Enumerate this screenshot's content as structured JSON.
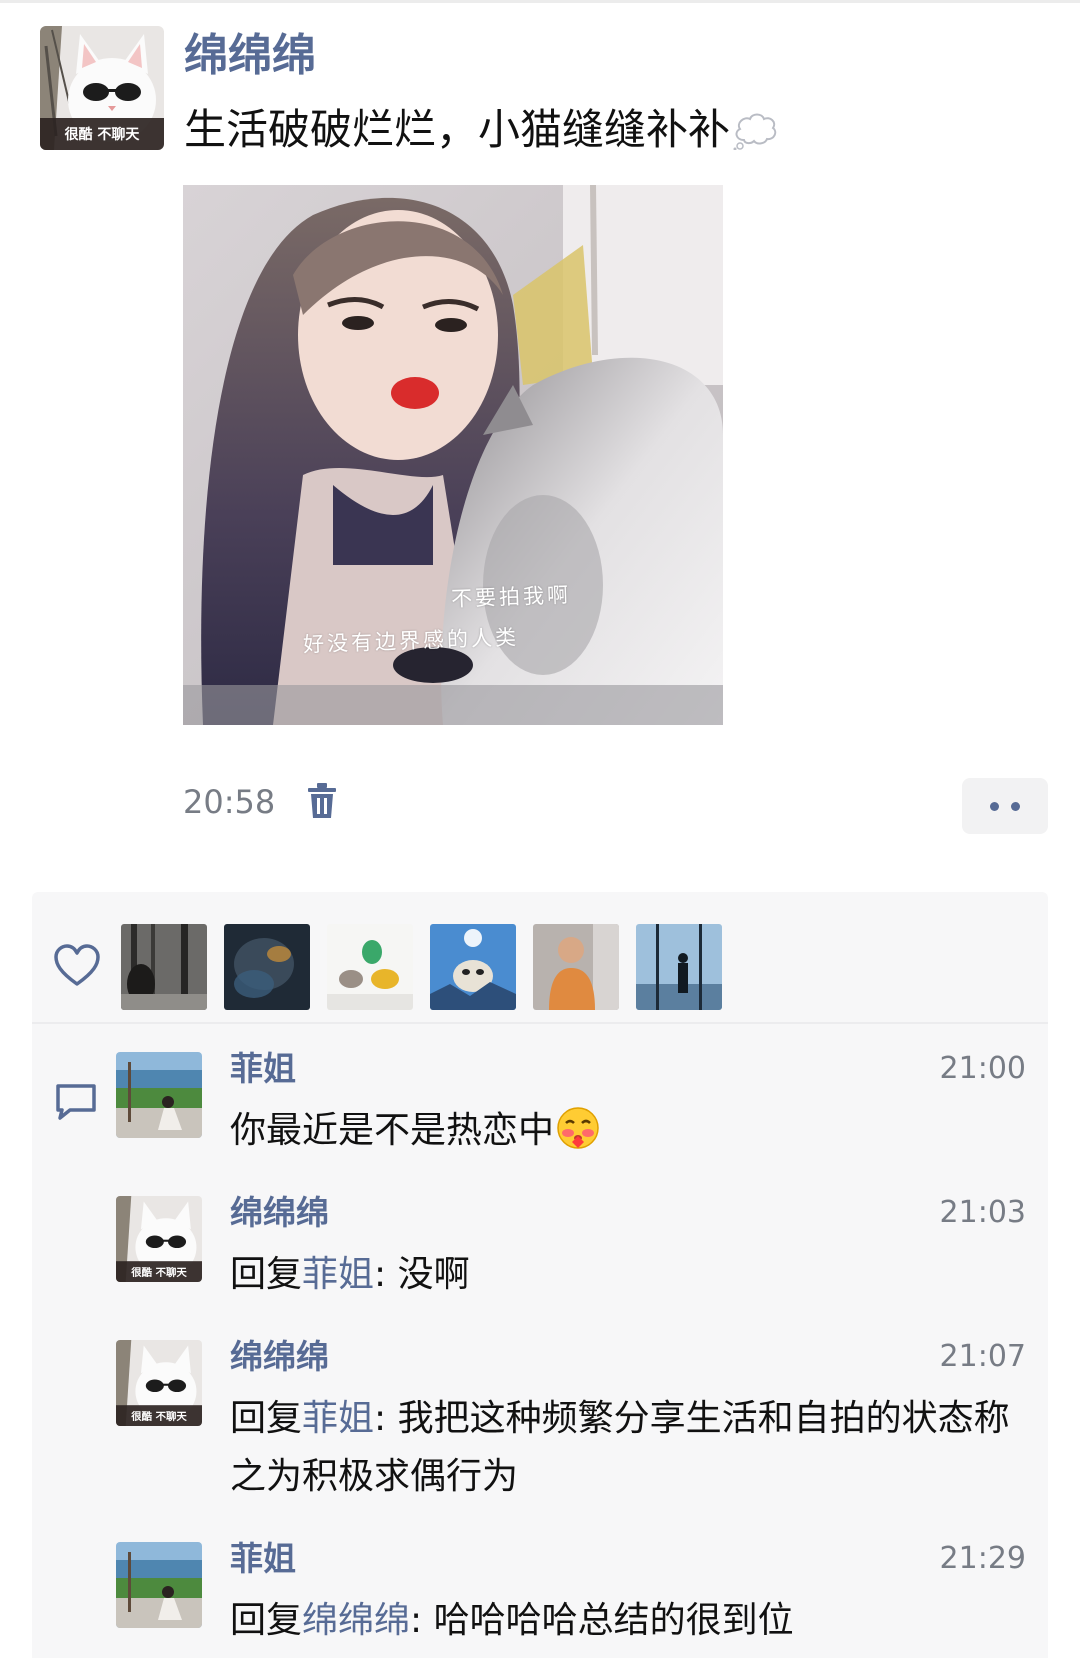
{
  "post": {
    "author": "绵绵绵",
    "text": "生活破破烂烂，小猫缝缝补补",
    "text_emoji_icon": "thought-balloon-icon",
    "photo": {
      "caption_top": "不要拍我啊",
      "caption_bottom": "好没有边界感的人类"
    },
    "time": "20:58",
    "delete_icon": "trash-icon",
    "more_icon": "more-dots-icon",
    "avatar_badge": "很酷 不聊天"
  },
  "likes": {
    "icon": "heart-outline-icon",
    "avatars": [
      {
        "name": "like-avatar-forest"
      },
      {
        "name": "like-avatar-blurred"
      },
      {
        "name": "like-avatar-toys"
      },
      {
        "name": "like-avatar-sky-animal"
      },
      {
        "name": "like-avatar-man-orange"
      },
      {
        "name": "like-avatar-window-silhouette"
      }
    ]
  },
  "comments": {
    "icon": "comment-bubble-icon",
    "items": [
      {
        "author": "菲姐",
        "time": "21:00",
        "text": "你最近是不是热恋中",
        "emoji": "blushing-face-icon"
      },
      {
        "author": "绵绵绵",
        "time": "21:03",
        "reply_word": "回复",
        "reply_to": "菲姐",
        "text": ": 没啊",
        "avatar_badge": "很酷 不聊天"
      },
      {
        "author": "绵绵绵",
        "time": "21:07",
        "reply_word": "回复",
        "reply_to": "菲姐",
        "text": ": 我把这种频繁分享生活和自拍的状态称之为积极求偶行为",
        "avatar_badge": "很酷 不聊天"
      },
      {
        "author": "菲姐",
        "time": "21:29",
        "reply_word": "回复",
        "reply_to": "绵绵绵",
        "text": ": 哈哈哈哈总结的很到位"
      }
    ]
  },
  "colors": {
    "link_blue": "#576b95",
    "panel_bg": "#f7f7f8",
    "meta_gray": "#777c85"
  }
}
